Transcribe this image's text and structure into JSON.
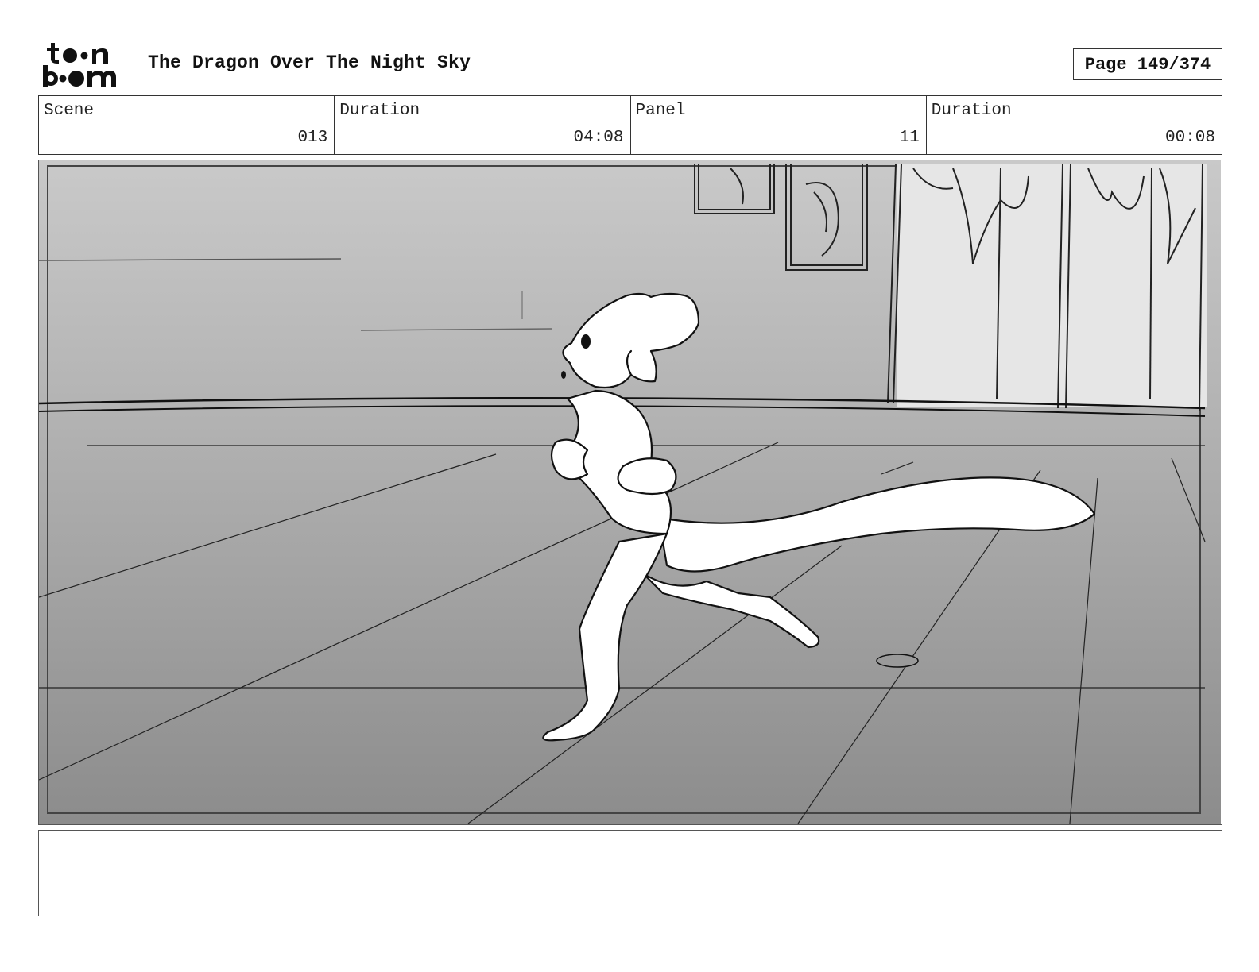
{
  "header": {
    "logo_text": "toon boom",
    "title": "The Dragon Over The Night Sky",
    "page": "Page 149/374"
  },
  "info": {
    "scene_label": "Scene",
    "scene_value": "013",
    "scene_duration_label": "Duration",
    "scene_duration_value": "04:08",
    "panel_label": "Panel",
    "panel_value": "11",
    "panel_duration_label": "Duration",
    "panel_duration_value": "00:08"
  },
  "notes": {
    "text": ""
  }
}
